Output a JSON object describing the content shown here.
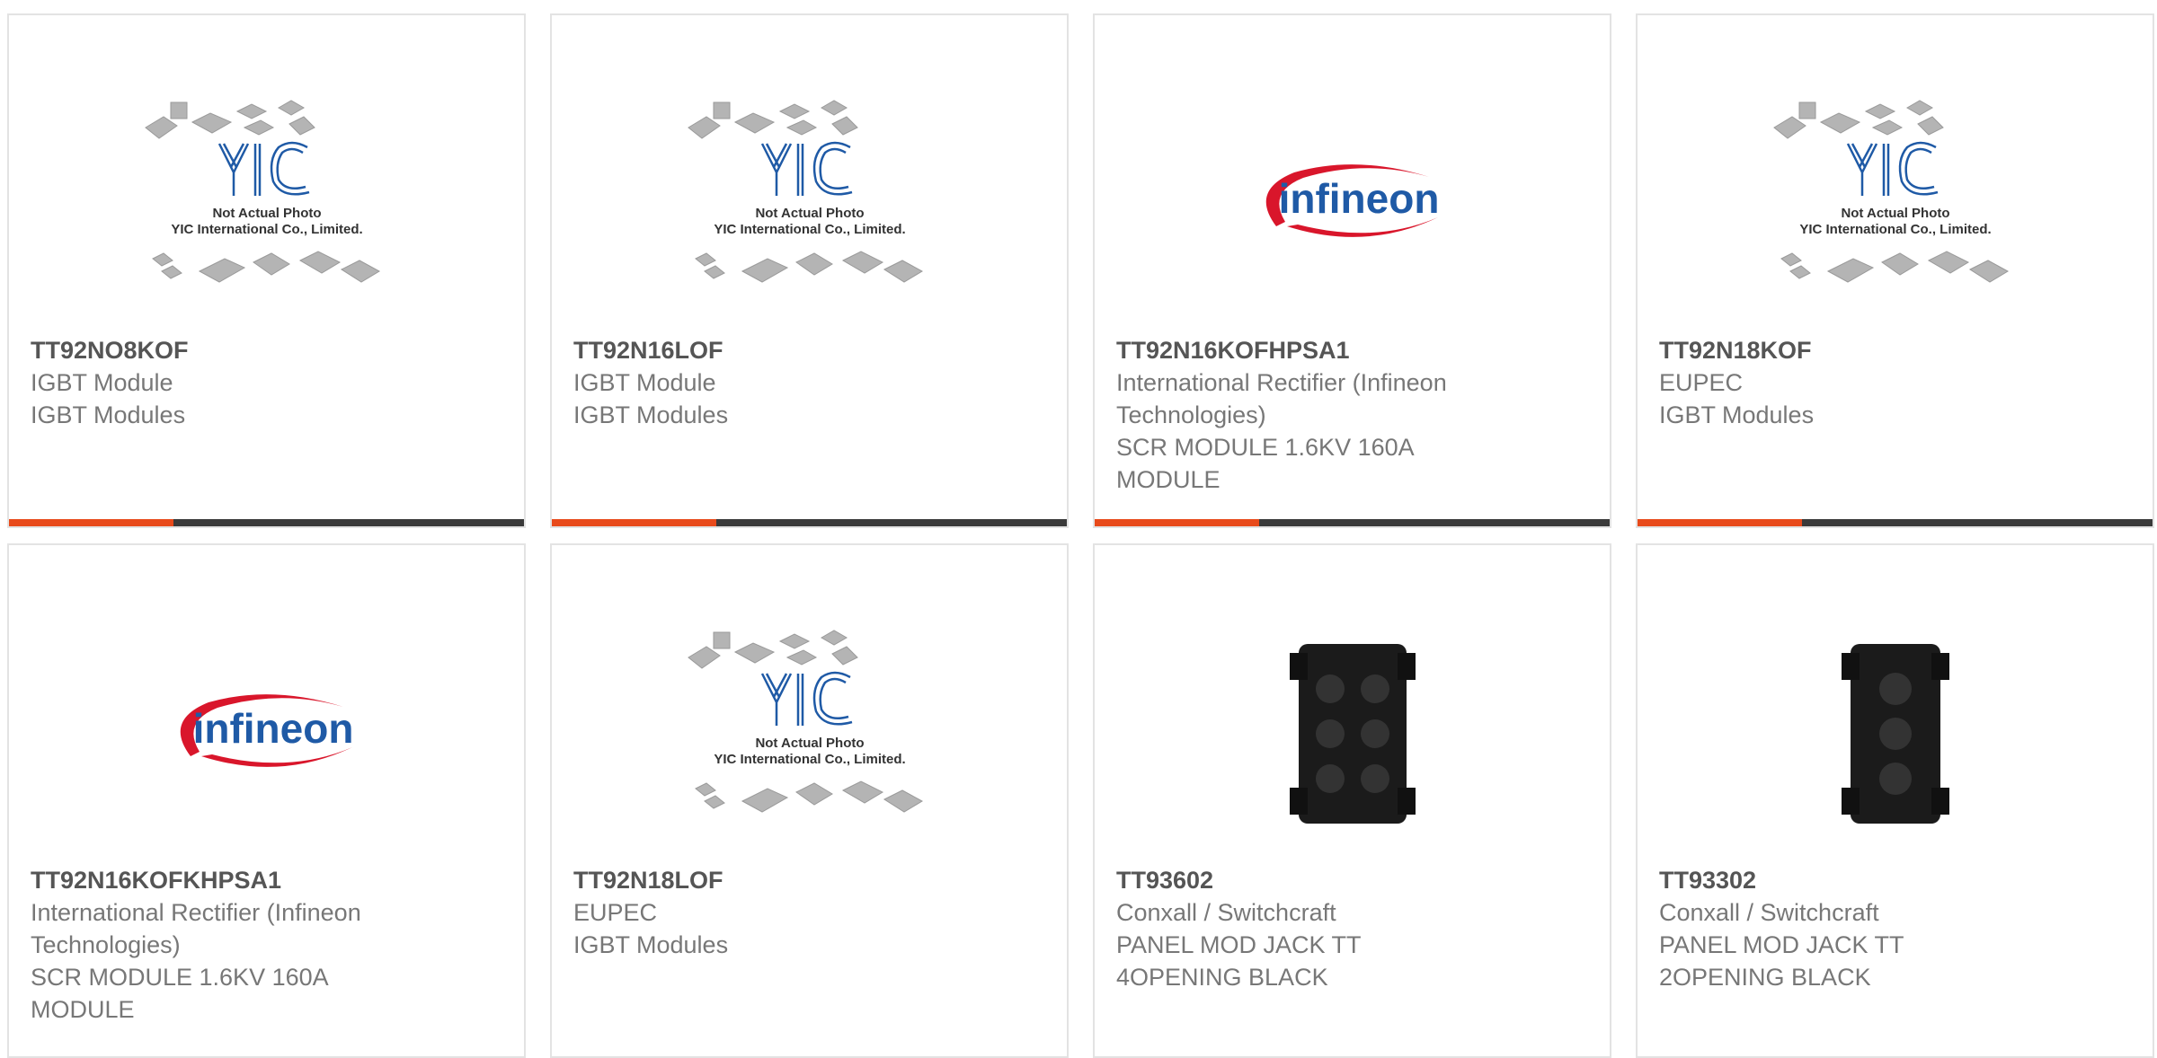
{
  "placeholder": {
    "line1": "Not Actual Photo",
    "line2": "YIC International Co., Limited.",
    "logo_text": "YIC"
  },
  "brand_logo_text": "infineon",
  "colors": {
    "accent": "#e84a1b",
    "bar_dark": "#3a3a3a",
    "infineon_red": "#d9162b",
    "infineon_blue": "#1f5aa6"
  },
  "cards": [
    {
      "part": "TT92NO8KOF",
      "lines": [
        "IGBT Module",
        "IGBT Modules"
      ],
      "image": "yic-placeholder"
    },
    {
      "part": "TT92N16LOF",
      "lines": [
        "IGBT Module",
        "IGBT Modules"
      ],
      "image": "yic-placeholder"
    },
    {
      "part": "TT92N16KOFHPSA1",
      "lines": [
        "International Rectifier (Infineon",
        "Technologies)",
        "SCR MODULE 1.6KV 160A",
        "MODULE"
      ],
      "image": "infineon-logo"
    },
    {
      "part": "TT92N18KOF",
      "lines": [
        "EUPEC",
        "IGBT Modules"
      ],
      "image": "yic-placeholder"
    },
    {
      "part": "TT92N16KOFKHPSA1",
      "lines": [
        "International Rectifier (Infineon",
        "Technologies)",
        "SCR MODULE 1.6KV 160A",
        "MODULE"
      ],
      "image": "infineon-logo"
    },
    {
      "part": "TT92N18LOF",
      "lines": [
        "EUPEC",
        "IGBT Modules"
      ],
      "image": "yic-placeholder"
    },
    {
      "part": "TT93602",
      "lines": [
        "Conxall / Switchcraft",
        "PANEL MOD JACK TT",
        "4OPENING BLACK"
      ],
      "image": "jack-panel-4"
    },
    {
      "part": "TT93302",
      "lines": [
        "Conxall / Switchcraft",
        "PANEL MOD JACK TT",
        "2OPENING BLACK"
      ],
      "image": "jack-panel-2"
    }
  ]
}
